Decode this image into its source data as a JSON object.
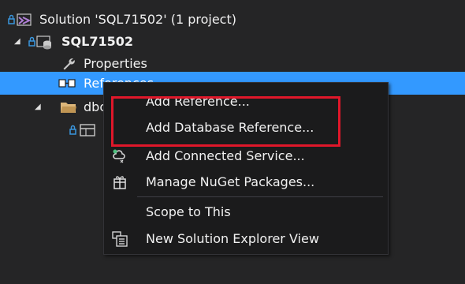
{
  "tree": {
    "solution_label": "Solution 'SQL71502' (1 project)",
    "project_label": "SQL71502",
    "properties_label": "Properties",
    "references_label": "References",
    "dbo_label": "dbo"
  },
  "context_menu": {
    "items": [
      {
        "label": "Add Reference...",
        "icon": "none"
      },
      {
        "label": "Add Database Reference...",
        "icon": "none"
      },
      {
        "label": "Add Connected Service...",
        "icon": "connected-service-icon"
      },
      {
        "label": "Manage NuGet Packages...",
        "icon": "nuget-package-icon"
      },
      {
        "label": "Scope to This",
        "icon": "none"
      },
      {
        "label": "New Solution Explorer View",
        "icon": "new-explorer-view-icon"
      }
    ]
  },
  "colors": {
    "background": "#252526",
    "selection": "#3399ff",
    "menu_background": "#1b1b1c",
    "highlight_box": "#e0172a"
  }
}
